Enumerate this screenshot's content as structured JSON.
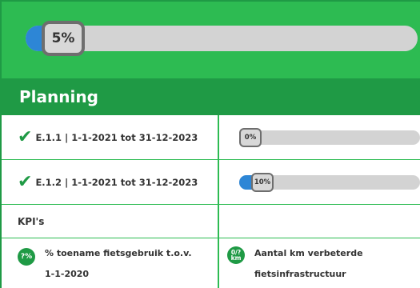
{
  "overall_progress": {
    "label": "5%",
    "value_percent": 5
  },
  "planning": {
    "title": "Planning",
    "tasks": [
      {
        "label": "E.1.1 | 1-1-2021 tot 31-12-2023",
        "status_icon": "check-icon",
        "progress_label": "0%",
        "progress_percent": 0
      },
      {
        "label": "E.1.2 | 1-1-2021 tot 31-12-2023",
        "status_icon": "check-icon",
        "progress_label": "10%",
        "progress_percent": 10
      }
    ]
  },
  "kpis": {
    "header": "KPI's",
    "items": [
      {
        "badge": "?%",
        "text_line1": "% toename fietsgebruik t.o.v.",
        "text_line2": "1-1-2020"
      },
      {
        "badge_line1": "0/?",
        "badge_line2": "km",
        "text_line1": "Aantal km verbeterde",
        "text_line2": "fietsinfrastructuur"
      }
    ]
  },
  "colors": {
    "green_light": "#2dbb52",
    "green_dark": "#1f9a45",
    "progress_blue": "#2d86d6",
    "track_gray": "#d3d3d3"
  }
}
